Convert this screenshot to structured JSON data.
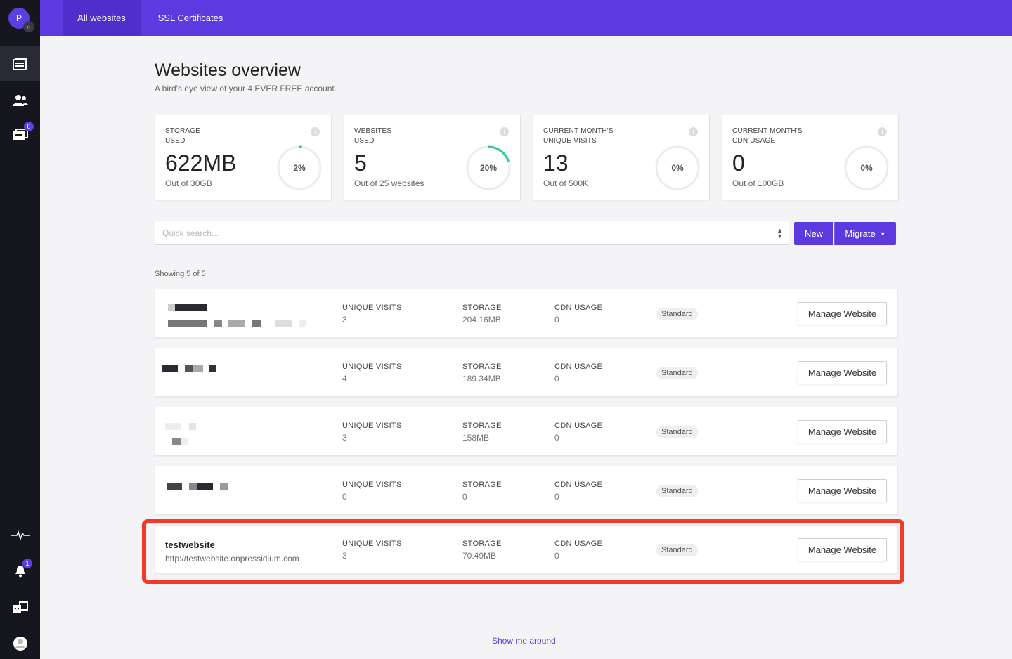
{
  "sidebar": {
    "avatar_initial": "P",
    "messages_badge": "0",
    "notifications_badge": "1"
  },
  "topbar": {
    "tabs": [
      {
        "label": "All websites"
      },
      {
        "label": "SSL Certificates"
      }
    ]
  },
  "page": {
    "title": "Websites overview",
    "subtitle": "A bird's eye view of your 4 EVER FREE account."
  },
  "stats": [
    {
      "label_line1": "STORAGE",
      "label_line2": "USED",
      "value": "622MB",
      "sub": "Out of 30GB",
      "percent_label": "2%",
      "percent": 2
    },
    {
      "label_line1": "WEBSITES",
      "label_line2": "USED",
      "value": "5",
      "sub": "Out of 25 websites",
      "percent_label": "20%",
      "percent": 20
    },
    {
      "label_line1": "CURRENT MONTH'S",
      "label_line2": "UNIQUE VISITS",
      "value": "13",
      "sub": "Out of 500K",
      "percent_label": "0%",
      "percent": 0
    },
    {
      "label_line1": "CURRENT MONTH'S",
      "label_line2": "CDN USAGE",
      "value": "0",
      "sub": "Out of 100GB",
      "percent_label": "0%",
      "percent": 0
    }
  ],
  "toolbar": {
    "search_placeholder": "Quick search...",
    "new_label": "New",
    "migrate_label": "Migrate"
  },
  "list": {
    "showing": "Showing 5 of 5",
    "columns": {
      "visits": "UNIQUE VISITS",
      "storage": "STORAGE",
      "cdn": "CDN USAGE"
    },
    "manage_label": "Manage Website",
    "rows": [
      {
        "name": "",
        "url": "",
        "visits": "3",
        "storage": "204.16MB",
        "cdn": "0",
        "plan": "Standard"
      },
      {
        "name": "",
        "url": "",
        "visits": "4",
        "storage": "189.34MB",
        "cdn": "0",
        "plan": "Standard"
      },
      {
        "name": "",
        "url": "",
        "visits": "3",
        "storage": "158MB",
        "cdn": "0",
        "plan": "Standard"
      },
      {
        "name": "",
        "url": "",
        "visits": "0",
        "storage": "0",
        "cdn": "0",
        "plan": "Standard"
      },
      {
        "name": "testwebsite",
        "url": "http://testwebsite.onpressidium.com",
        "visits": "3",
        "storage": "70.49MB",
        "cdn": "0",
        "plan": "Standard"
      }
    ]
  },
  "footer": {
    "show_around": "Show me around"
  },
  "colors": {
    "brand": "#5b3bdf",
    "gauge": "#2ecc8f",
    "highlight": "#f23a2a"
  }
}
